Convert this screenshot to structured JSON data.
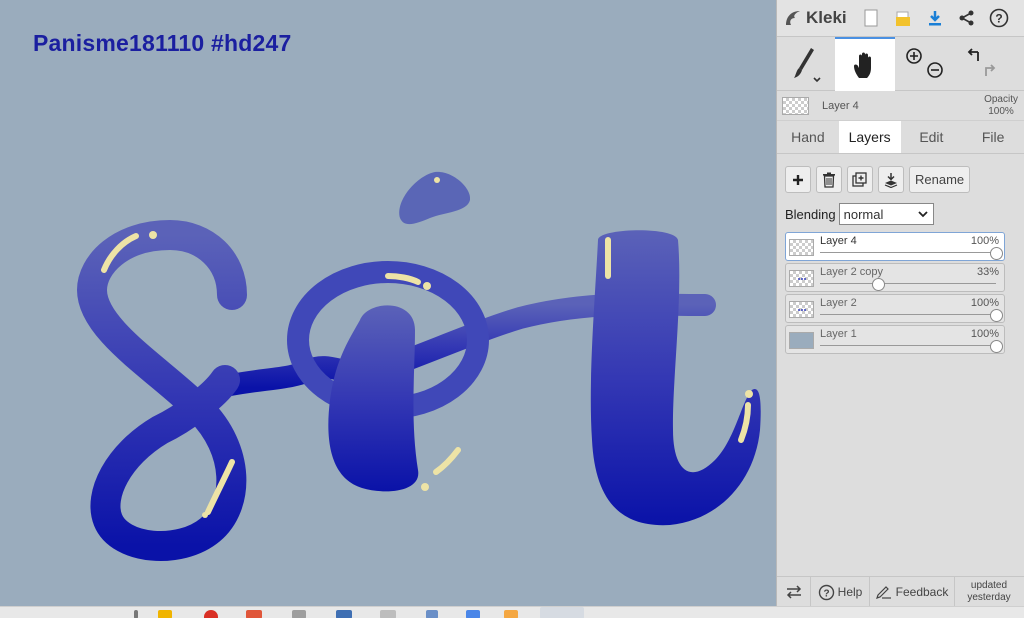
{
  "canvas": {
    "caption": "Panisme181110 #hd247",
    "background_color": "#9aacbd",
    "text_color": "#1b1fa0"
  },
  "panel": {
    "logo": "Kleki",
    "top_icons": [
      "new-image-icon",
      "open-folder-icon",
      "download-icon",
      "share-icon",
      "help-icon"
    ],
    "tools": [
      "brush-icon",
      "hand-icon",
      "zoom-in-icon",
      "zoom-out-icon",
      "undo-icon",
      "redo-icon"
    ],
    "active_layer": {
      "name": "Layer 4",
      "opacity_label": "Opacity",
      "opacity_value": "100%"
    },
    "tabs": [
      {
        "label": "Hand"
      },
      {
        "label": "Layers"
      },
      {
        "label": "Edit"
      },
      {
        "label": "File"
      }
    ],
    "active_tab": "Layers",
    "actions": {
      "rename": "Rename"
    },
    "blending": {
      "label": "Blending",
      "value": "normal"
    },
    "layers": [
      {
        "name": "Layer 4",
        "opacity_label": "100%",
        "opacity": 1.0
      },
      {
        "name": "Layer 2 copy",
        "opacity_label": "33%",
        "opacity": 0.33
      },
      {
        "name": "Layer 2",
        "opacity_label": "100%",
        "opacity": 1.0
      },
      {
        "name": "Layer 1",
        "opacity_label": "100%",
        "opacity": 1.0
      }
    ],
    "bottom": {
      "help": "Help",
      "feedback": "Feedback",
      "updated_line1": "updated",
      "updated_line2": "yesterday"
    },
    "accent_color": "#4a90e2"
  }
}
